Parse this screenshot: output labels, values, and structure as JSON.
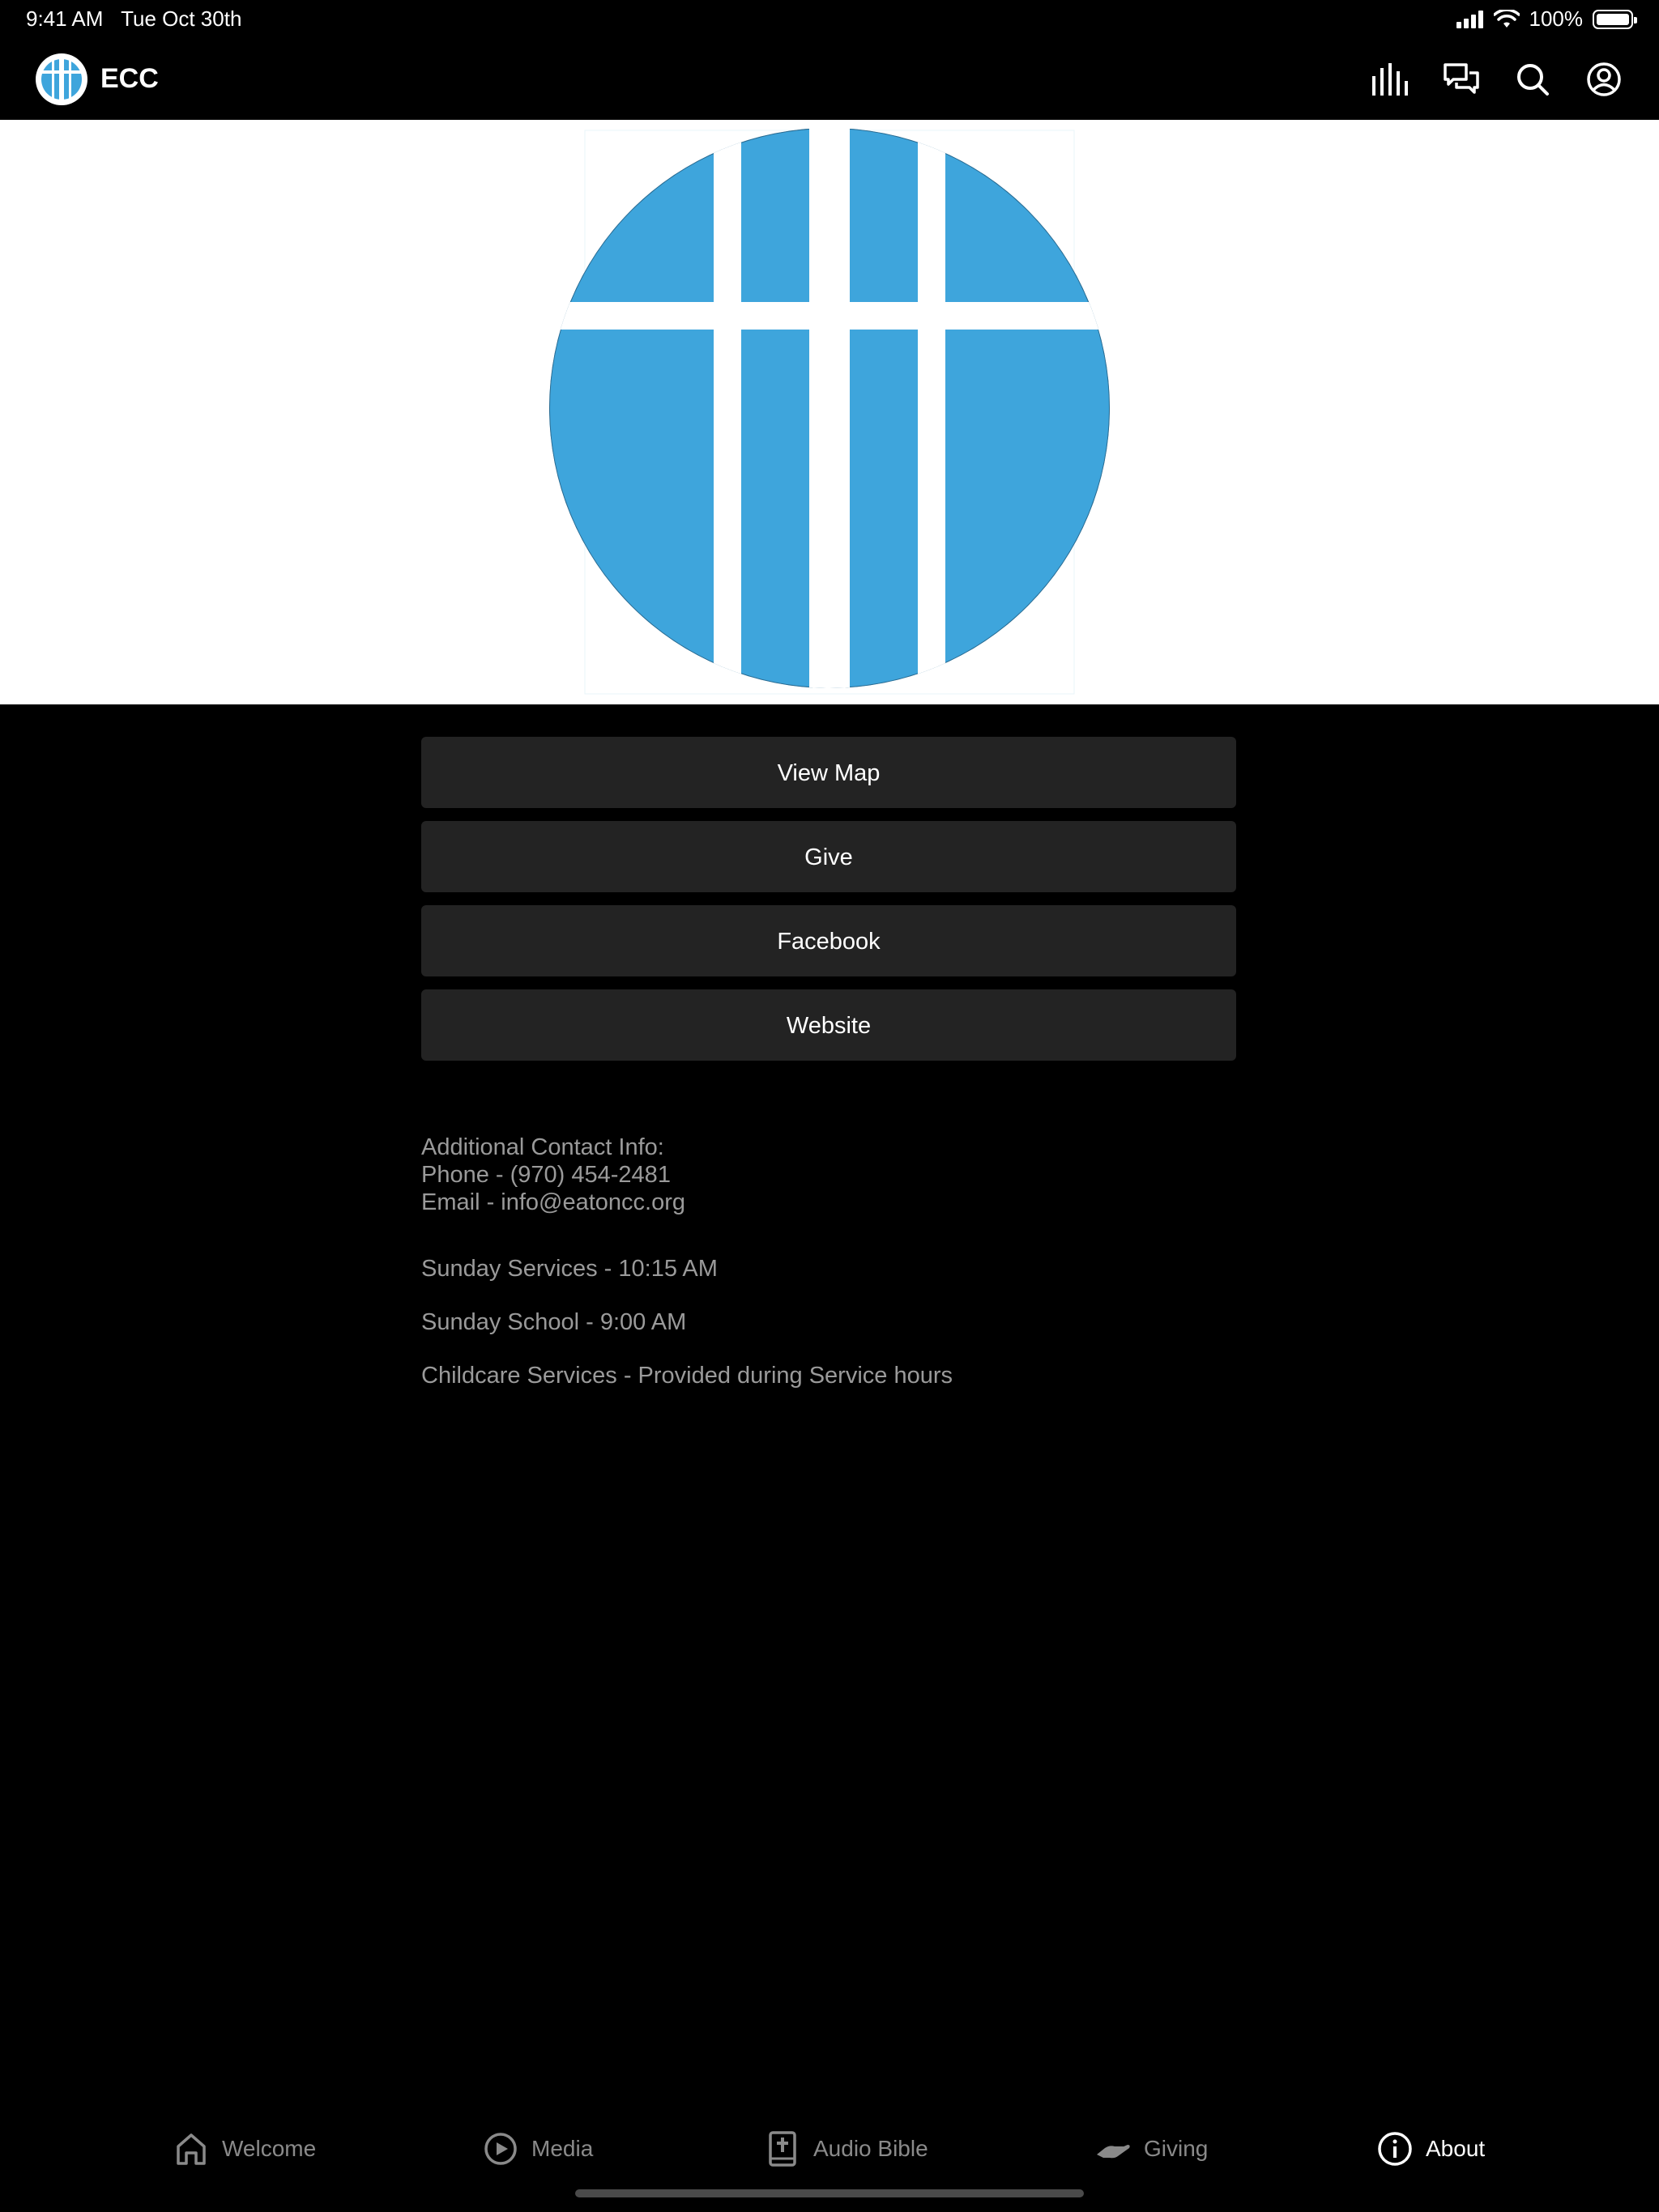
{
  "status": {
    "time": "9:41 AM",
    "date": "Tue Oct 30th",
    "battery": "100%"
  },
  "header": {
    "title": "ECC",
    "icons": [
      "equalizer-icon",
      "chat-icon",
      "search-icon",
      "profile-icon"
    ]
  },
  "hero": {
    "logo_color": "#3ea5dc"
  },
  "actions": [
    {
      "label": "View Map"
    },
    {
      "label": "Give"
    },
    {
      "label": "Facebook"
    },
    {
      "label": "Website"
    }
  ],
  "info": {
    "contact_heading": "Additional Contact Info:",
    "phone": "Phone - (970) 454-2481",
    "email": "Email - info@eatoncc.org",
    "services": "Sunday Services - 10:15 AM",
    "school": "Sunday School - 9:00 AM",
    "childcare": "Childcare Services - Provided during Service hours"
  },
  "tabs": [
    {
      "label": "Welcome",
      "icon": "home-icon"
    },
    {
      "label": "Media",
      "icon": "play-icon"
    },
    {
      "label": "Audio Bible",
      "icon": "bible-icon"
    },
    {
      "label": "Giving",
      "icon": "giving-hand-icon"
    },
    {
      "label": "About",
      "icon": "info-icon",
      "active": true
    }
  ]
}
